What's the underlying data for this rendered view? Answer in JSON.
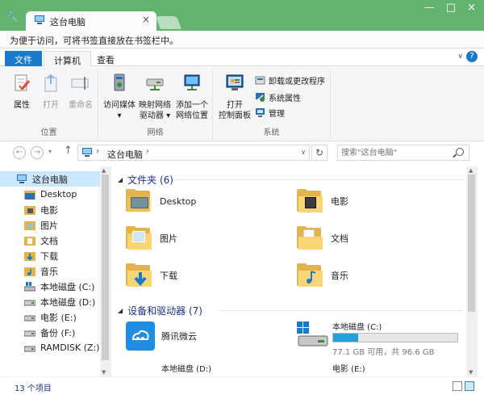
{
  "browser": {
    "tab_title": "这台电脑",
    "tab_close": "×",
    "window_controls": [
      "—",
      "□",
      "×"
    ],
    "bookmark_hint": "为便于访问，可将书签直接放在书签栏中。"
  },
  "ribbon": {
    "tabs": [
      "文件",
      "计算机",
      "查看"
    ],
    "groups": {
      "location": {
        "label": "位置",
        "buttons": [
          "属性",
          "打开",
          "重命名"
        ]
      },
      "network": {
        "label": "网络",
        "buttons": [
          {
            "line1": "访问媒体",
            "line2": "▾"
          },
          {
            "line1": "映射网络",
            "line2": "驱动器 ▾"
          },
          {
            "line1": "添加一个",
            "line2": "网络位置"
          }
        ]
      },
      "system": {
        "label": "系统",
        "big_button": {
          "line1": "打开",
          "line2": "控制面板"
        },
        "small_buttons": [
          "卸载或更改程序",
          "系统属性",
          "管理"
        ]
      }
    }
  },
  "address": {
    "path": "这台电脑",
    "search_placeholder": "搜索\"这台电脑\""
  },
  "nav_pane": {
    "items": [
      {
        "label": "这台电脑",
        "icon": "computer-icon",
        "selected": true
      },
      {
        "label": "Desktop",
        "icon": "folder-icon"
      },
      {
        "label": "电影",
        "icon": "folder-icon"
      },
      {
        "label": "图片",
        "icon": "folder-icon"
      },
      {
        "label": "文档",
        "icon": "folder-icon"
      },
      {
        "label": "下载",
        "icon": "folder-icon"
      },
      {
        "label": "音乐",
        "icon": "folder-icon"
      },
      {
        "label": "本地磁盘 (C:)",
        "icon": "drive-icon"
      },
      {
        "label": "本地磁盘 (D:)",
        "icon": "drive-icon"
      },
      {
        "label": "电影 (E:)",
        "icon": "drive-icon"
      },
      {
        "label": "备份 (F:)",
        "icon": "drive-icon"
      },
      {
        "label": "RAMDISK (Z:)",
        "icon": "drive-icon"
      }
    ]
  },
  "content": {
    "folders_header": "文件夹 (6)",
    "folders": [
      "Desktop",
      "电影",
      "图片",
      "文档",
      "下载",
      "音乐"
    ],
    "devices_header": "设备和驱动器 (7)",
    "devices": [
      {
        "label": "腾讯微云"
      },
      {
        "label": "本地磁盘 (C:)",
        "free_text": "77.1 GB 可用，共 96.6 GB",
        "used_fraction": 0.2
      },
      {
        "label": "本地磁盘 (D:)"
      },
      {
        "label": "电影 (E:)"
      }
    ]
  },
  "status": {
    "item_count": "13 个项目"
  },
  "colors": {
    "accent": "#1979ca",
    "browser_green": "#62b36d",
    "folder": "#f8d575",
    "drive_fill": "#26a0da",
    "header_text": "#1e3287"
  }
}
